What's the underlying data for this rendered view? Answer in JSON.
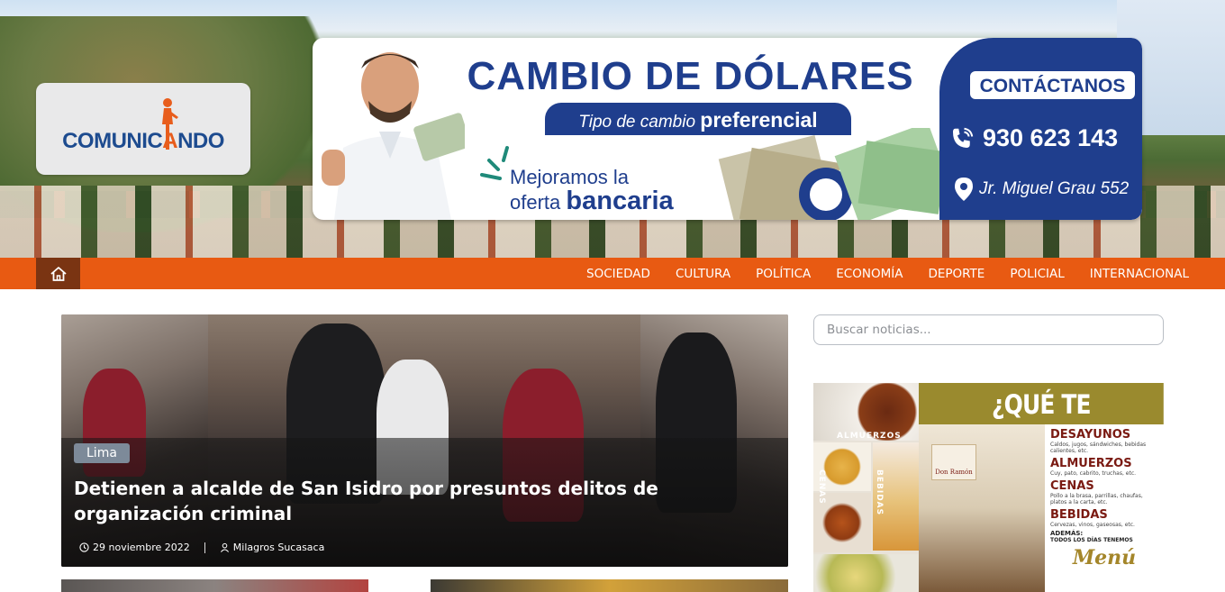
{
  "header": {
    "logo_text_left": "COMUNIC",
    "logo_text_right": "NDO"
  },
  "ad_banner": {
    "title": "CAMBIO DE DÓLARES",
    "subtitle_italic": "Tipo de cambio",
    "subtitle_bold": "preferencial",
    "tagline_line1": "Mejoramos la",
    "tagline_line2_a": "oferta",
    "tagline_line2_b": "bancaria",
    "contact_label": "CONTÁCTANOS",
    "phone": "930 623 143",
    "address": "Jr. Miguel Grau 552",
    "brand_color": "#1f3e8d"
  },
  "nav": {
    "home_icon": "home-icon",
    "items": [
      "SOCIEDAD",
      "CULTURA",
      "POLÍTICA",
      "ECONOMÍA",
      "DEPORTE",
      "POLICIAL",
      "INTERNACIONAL"
    ],
    "bar_color": "#e85a12",
    "home_color": "#7a3412"
  },
  "featured": {
    "category": "Lima",
    "title": "Detienen a alcalde de San Isidro por presuntos delitos de organización criminal",
    "date": "29 noviembre 2022",
    "author": "Milagros Sucasaca",
    "date_icon": "clock-icon",
    "author_icon": "user-icon"
  },
  "sidebar": {
    "search_placeholder": "Buscar noticias...",
    "promo": {
      "headline": "¿QUÉ TE OFRECEMOS?",
      "labels": {
        "almuerzos": "ALMUERZOS",
        "cenas": "CENAS",
        "bebidas": "BEBIDAS"
      },
      "menu": [
        {
          "title": "DESAYUNOS",
          "desc": "Caldos, jugos, sándwiches, bebidas calientes, etc."
        },
        {
          "title": "ALMUERZOS",
          "desc": "Cuy, pato, cabrito, truchas, etc."
        },
        {
          "title": "CENAS",
          "desc": "Pollo a la brasa, parrillas, chaufas, platos a la carta, etc."
        },
        {
          "title": "BEBIDAS",
          "desc": "Cervezas, vinos, gaseosas, etc."
        }
      ],
      "extra_title": "ADEMÁS:",
      "extra_desc": "TODOS LOS DÍAS TENEMOS",
      "footer": "Menú",
      "restaurant_sign": "Don Ramón"
    }
  }
}
